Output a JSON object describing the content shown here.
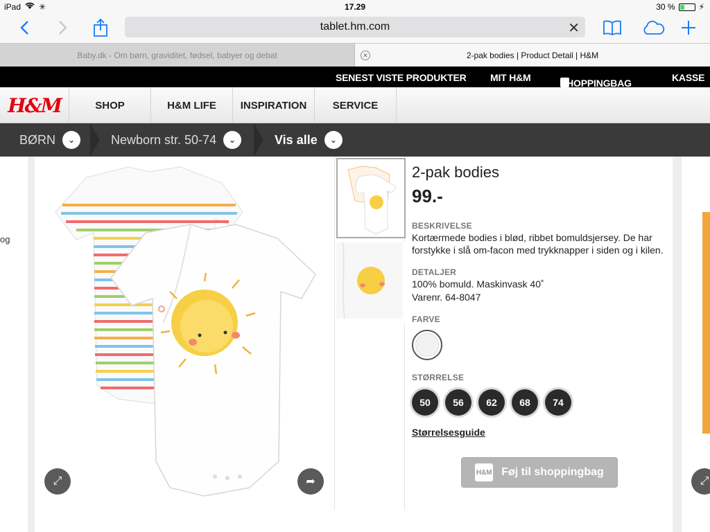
{
  "statusbar": {
    "device": "iPad",
    "time": "17.29",
    "battery": "30 %",
    "battery_level": 0.3
  },
  "browser": {
    "url": "tablet.hm.com",
    "tabs": [
      {
        "title": "Baby.dk - Om børn, graviditet, fødsel, babyer og debat"
      },
      {
        "title": "2-pak bodies | Product Detail | H&M"
      }
    ]
  },
  "topbar": {
    "recent": "SENEST VISTE PRODUKTER",
    "my_hm": "MIT H&M",
    "bag": "SHOPPINGBAG",
    "checkout": "KASSE"
  },
  "logo": "H&M",
  "nav": [
    "SHOP",
    "H&M LIFE",
    "INSPIRATION",
    "SERVICE"
  ],
  "breadcrumb": [
    "BØRN",
    "Newborn str. 50-74",
    "Vis alle"
  ],
  "left_edge_text": "og",
  "product": {
    "title": "2-pak bodies",
    "price": "99.-",
    "description_label": "BESKRIVELSE",
    "description": "Kortærmede bodies i blød, ribbet bomuldsjersey. De har forstykke i slå om-facon med trykknapper i siden og i kilen.",
    "details_label": "DETALJER",
    "details_line1": "100% bomuld. Maskinvask 40˚",
    "details_line2": "Varenr. 64-8047",
    "color_label": "FARVE",
    "size_label": "STØRRELSE",
    "sizes": [
      "50",
      "56",
      "62",
      "68",
      "74"
    ],
    "size_guide": "Størrelsesguide",
    "add_to_bag": "Føj til shoppingbag"
  },
  "colors": {
    "hm_red": "#e50010",
    "accent_blue": "#1a7cf5"
  }
}
